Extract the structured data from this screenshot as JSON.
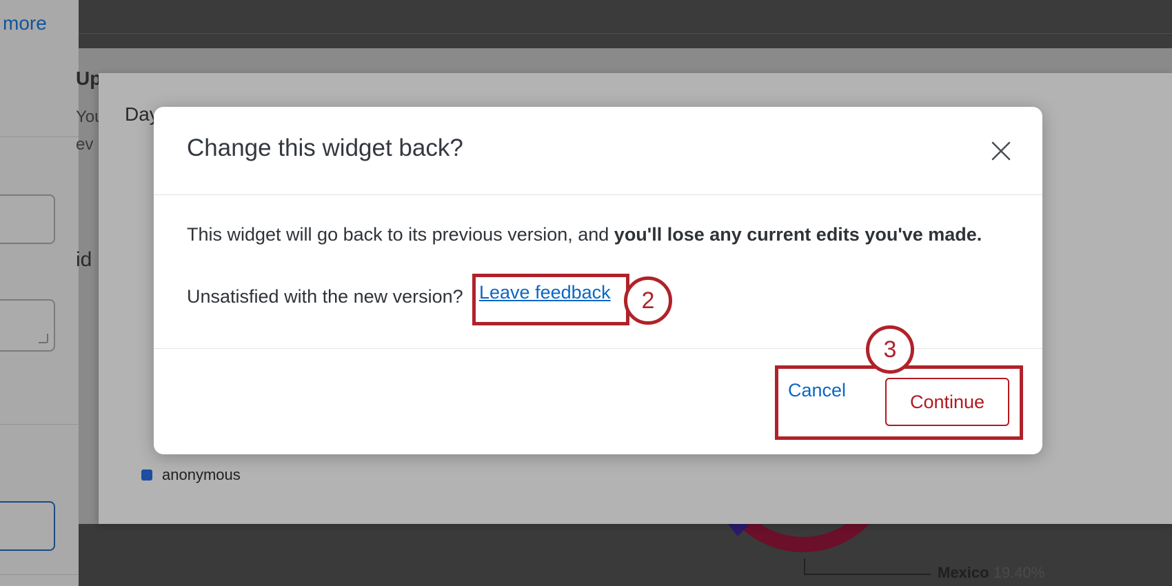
{
  "background": {
    "left_panel_link": "more",
    "editor_title": "Day",
    "legend_item": "anonymous",
    "map_label": {
      "country": "Mexico",
      "percent": "19.40%"
    }
  },
  "modal": {
    "title": "Change this widget back?",
    "body_text": "This widget will go back to its previous version, and ",
    "body_bold": "you'll lose any current edits you've made.",
    "feedback_prompt": "Unsatisfied with the new version?",
    "feedback_link": "Leave feedback",
    "cancel_label": "Cancel",
    "continue_label": "Continue"
  },
  "annotations": {
    "step_2": "2",
    "step_3": "3"
  },
  "colors": {
    "accent_red": "#b0222a",
    "link_blue": "#0b67c4"
  }
}
